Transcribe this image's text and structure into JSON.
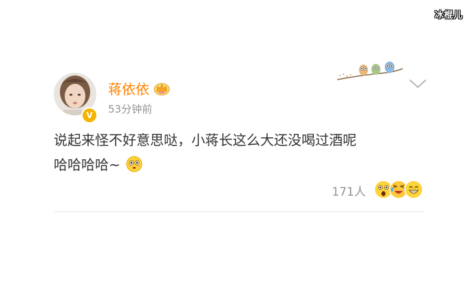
{
  "watermark": "冰棍儿",
  "post": {
    "author": "蒋依依",
    "author_badge_icon": "crown-icon",
    "verified_icon": "verified-badge-icon",
    "timestamp": "53分钟前",
    "content_line1": "说起来怪不好意思哒，小蒋长这么大还没喝过酒呢",
    "content_line2": "哈哈哈哈~",
    "content_emoji": "flushed-face-emoji",
    "like_count": "171人",
    "reaction_icons": [
      "surprised-face-icon",
      "laughing-crying-face-icon",
      "grinning-face-icon"
    ],
    "decoration": "owls-on-branch",
    "more_icon": "chevron-down-icon"
  },
  "colors": {
    "author": "#ff8200",
    "content": "#333333",
    "meta": "#939393",
    "divider": "#e8e8e8"
  }
}
